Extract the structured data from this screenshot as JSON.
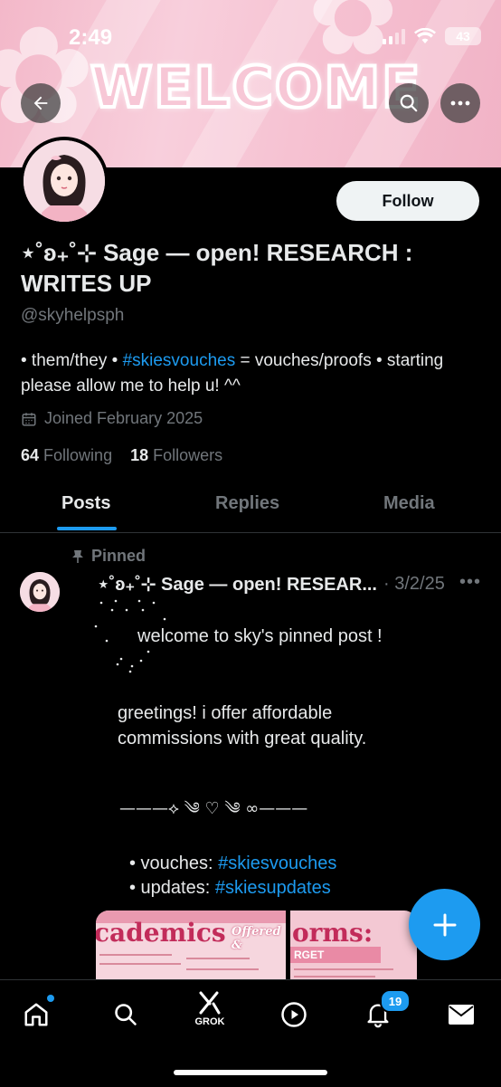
{
  "status_bar": {
    "time": "2:49",
    "battery": "43"
  },
  "banner": {
    "text": "WELCOME"
  },
  "profile": {
    "name": "⋆˚ʚ₊˚⊹ Sage — open! RESEARCH : WRITES UP",
    "handle": "@skyhelpsph",
    "bio_pre": "• them/they • ",
    "bio_tag": "#skiesvouches",
    "bio_post": " = vouches/proofs • starting please allow me to help u! ^^",
    "joined": "Joined February 2025",
    "following_count": "64",
    "following_label": "Following",
    "followers_count": "18",
    "followers_label": "Followers",
    "follow_label": "Follow"
  },
  "tabs": [
    {
      "label": "Posts",
      "active": true
    },
    {
      "label": "Replies"
    },
    {
      "label": "Media"
    }
  ],
  "post": {
    "pinned_label": "Pinned",
    "author": "⋆˚ʚ₊˚⊹ Sage — open! RESEAR...",
    "date": "· 3/2/25",
    "more": "•••",
    "line1": "welcome to sky's pinned post !",
    "line2": "greetings! i offer affordable commissions with great quality.",
    "separator": "———⟡ ༄ ♡ ༄ ∞———",
    "vouches_label": "• vouches: ",
    "vouches_tag": "#skiesvouches",
    "updates_label": "• updates: ",
    "updates_tag": "#skiesupdates",
    "image1_title": "cademics",
    "image1_sub": "Offered & ",
    "image2_title": "orms:",
    "image2_sub": "RGET"
  },
  "nav": {
    "grok_label": "GROK",
    "notifications_badge": "19"
  },
  "colors": {
    "accent": "#1d9bf0",
    "banner_pink": "#f3b8c9"
  }
}
